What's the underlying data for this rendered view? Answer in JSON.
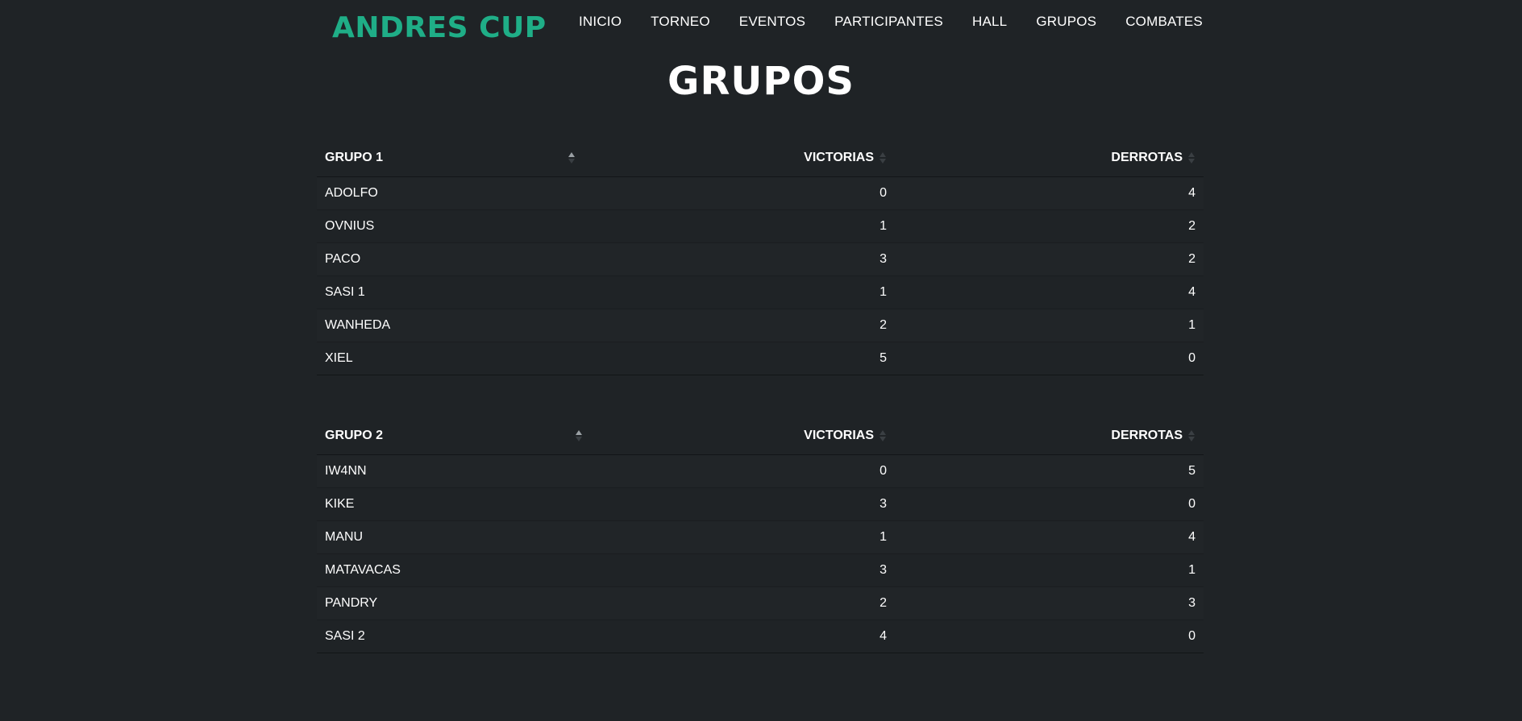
{
  "header": {
    "logo": "ANDRES CUP",
    "nav": [
      "INICIO",
      "TORNEO",
      "EVENTOS",
      "PARTICIPANTES",
      "HALL",
      "GRUPOS",
      "COMBATES"
    ]
  },
  "page_title": "GRUPOS",
  "groups": [
    {
      "name": "GRUPO 1",
      "col_wins": "VICTORIAS",
      "col_losses": "DERROTAS",
      "rows": [
        {
          "name": "ADOLFO",
          "wins": "0",
          "losses": "4"
        },
        {
          "name": "OVNIUS",
          "wins": "1",
          "losses": "2"
        },
        {
          "name": "PACO",
          "wins": "3",
          "losses": "2"
        },
        {
          "name": "SASI 1",
          "wins": "1",
          "losses": "4"
        },
        {
          "name": "WANHEDA",
          "wins": "2",
          "losses": "1"
        },
        {
          "name": "XIEL",
          "wins": "5",
          "losses": "0"
        }
      ]
    },
    {
      "name": "GRUPO 2",
      "col_wins": "VICTORIAS",
      "col_losses": "DERROTAS",
      "rows": [
        {
          "name": "IW4NN",
          "wins": "0",
          "losses": "5"
        },
        {
          "name": "KIKE",
          "wins": "3",
          "losses": "0"
        },
        {
          "name": "MANU",
          "wins": "1",
          "losses": "4"
        },
        {
          "name": "MATAVACAS",
          "wins": "3",
          "losses": "1"
        },
        {
          "name": "PANDRY",
          "wins": "2",
          "losses": "3"
        },
        {
          "name": "SASI 2",
          "wins": "4",
          "losses": "0"
        }
      ]
    }
  ],
  "colors": {
    "background": "#1f2326",
    "accent": "#1fae87",
    "text": "#ffffff"
  },
  "icons": {
    "sort_ascending": "sort-asc-icon",
    "sort_neutral": "sort-icon"
  }
}
